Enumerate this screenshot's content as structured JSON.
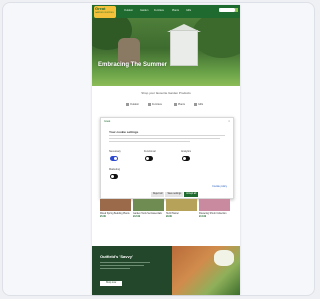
{
  "header": {
    "logo_text": "Great",
    "logo_sub": "GARDEN CENTRES",
    "nav": [
      "Outdoor",
      "Garden",
      "Furniture",
      "Plants",
      "Gifts"
    ]
  },
  "hero": {
    "title": "Embracing The Summer"
  },
  "intro": {
    "title": "Shop your favourite Garden Products",
    "chips": [
      "Outdoor",
      "Furniture",
      "Plants",
      "Gifts"
    ]
  },
  "cookie_dialog": {
    "brand": "Great",
    "close": "×",
    "title": "Your cookie settings",
    "categories": [
      {
        "label": "Necessary",
        "on": true
      },
      {
        "label": "Functional",
        "on": false
      },
      {
        "label": "Analytics",
        "on": false
      },
      {
        "label": "Marketing",
        "on": false
      }
    ],
    "link": "Cookie policy",
    "buttons": [
      "Reject all",
      "Save settings",
      "Accept all"
    ]
  },
  "products": [
    {
      "name": "Mixed Spring Bedding Plants",
      "price": "£5.99",
      "color": "#9b6a4a"
    },
    {
      "name": "Garden Tools Set Essentials",
      "price": "£12.99",
      "color": "#6f8c52"
    },
    {
      "name": "Herb Planter",
      "price": "£8.99",
      "color": "#b7a25a"
    },
    {
      "name": "Flowering Shrub Collection",
      "price": "£14.99",
      "color": "#c98aa0"
    }
  ],
  "promo": {
    "title": "Outfield's 'Savvy'",
    "button": "Shop now"
  }
}
